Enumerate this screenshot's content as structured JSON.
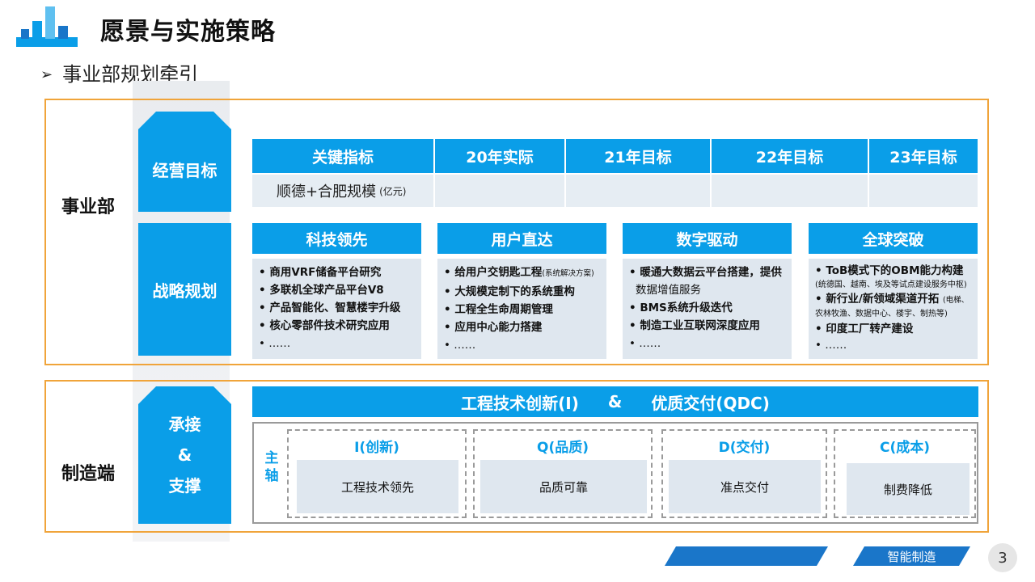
{
  "header": {
    "title": "愿景与实施策略",
    "subtitle_bullet": "➢",
    "subtitle": "事业部规划牵引"
  },
  "colors": {
    "accent": "#0a9ee8",
    "frame": "#f0a43a",
    "cell": "#dfe7ef",
    "footer": "#1a76c9"
  },
  "section1": {
    "label": "事业部",
    "goal_label": "经营目标",
    "strategy_label": "战略规划",
    "table": {
      "headers": [
        "关键指标",
        "20年实际",
        "21年目标",
        "22年目标",
        "23年目标"
      ],
      "row_label": "顺德+合肥规模",
      "row_unit": "(亿元)"
    },
    "columns": [
      {
        "title": "科技领先",
        "items": [
          "• 商用VRF储备平台研究",
          "• 多联机全球产品平台V8",
          "• 产品智能化、智慧楼宇升级",
          "• 核心零部件技术研究应用",
          "• ……"
        ]
      },
      {
        "title": "用户直达",
        "items": [
          "• 给用户交钥匙工程",
          "• 大规模定制下的系统重构",
          "• 工程全生命周期管理",
          "• 应用中心能力搭建",
          "• ……"
        ],
        "note": "(系统解决方案)"
      },
      {
        "title": "数字驱动",
        "items": [
          "• 暖通大数据云平台搭建，提供",
          "数据增值服务",
          "• BMS系统升级迭代",
          "• 制造工业互联网深度应用",
          "• ……"
        ]
      },
      {
        "title": "全球突破",
        "items": [
          "• ToB模式下的OBM能力构建",
          "(统德国、越南、埃及等试点建设服务中枢)",
          "• 新行业/新领域渠道开拓",
          "农林牧渔、数据中心、楼宇、制热等)",
          "• 印度工厂转产建设",
          "• ……"
        ],
        "note": "(电梯、"
      }
    ]
  },
  "section2": {
    "label": "制造端",
    "support_line1": "承接",
    "support_line2": "&",
    "support_line3": "支撑",
    "banner_left": "工程技术创新(I)",
    "banner_mid": "&",
    "banner_right": "优质交付(QDC)",
    "axis_label": "主轴",
    "qdc": [
      {
        "title": "I(创新)",
        "body": "工程技术领先"
      },
      {
        "title": "Q(品质)",
        "body": "品质可靠"
      },
      {
        "title": "D(交付)",
        "body": "准点交付"
      },
      {
        "title": "C(成本)",
        "body": "制费降低"
      }
    ]
  },
  "footer": {
    "blank_tab": "",
    "tag": "智能制造",
    "page": "3"
  }
}
